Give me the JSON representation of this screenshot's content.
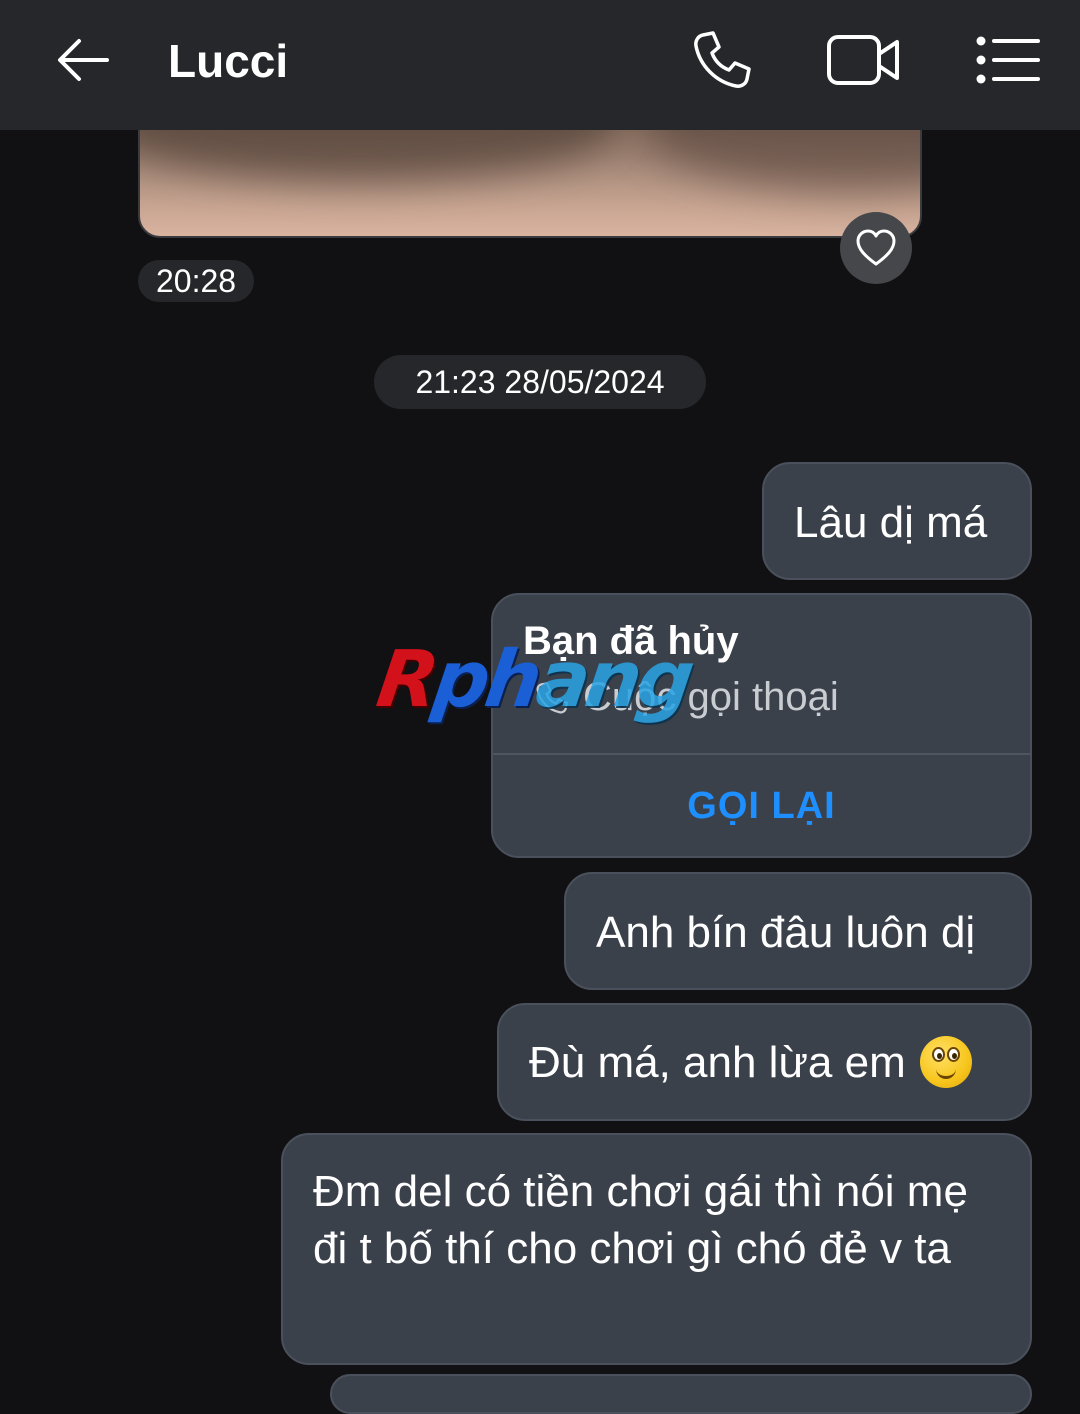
{
  "header": {
    "contact_name": "Lucci",
    "icons": [
      "back-arrow-icon",
      "phone-icon",
      "video-camera-icon",
      "menu-list-icon"
    ]
  },
  "photo_message": {
    "time": "20:28"
  },
  "date_separator": "21:23 28/05/2024",
  "messages": [
    {
      "text": "Lâu dị má"
    },
    {
      "type": "call",
      "status": "Bạn đã hủy",
      "call_label": "Cuộc gọi thoại",
      "action": "GỌI LẠI"
    },
    {
      "text": "Anh bín đâu luôn dị"
    },
    {
      "text": "Đù má, anh lừa em",
      "emoji": "smiling-face-with-wide-eyes"
    },
    {
      "text": "Đm del có tiền chơi gái thì nói mẹ đi t bố thí cho chơi gì chó đẻ v ta"
    }
  ],
  "watermark": {
    "part_a": "R",
    "part_b": "ph",
    "part_c": "ang"
  },
  "colors": {
    "background": "#111113",
    "header": "#26272a",
    "bubble": "#3b414b",
    "link": "#1e8fff"
  }
}
